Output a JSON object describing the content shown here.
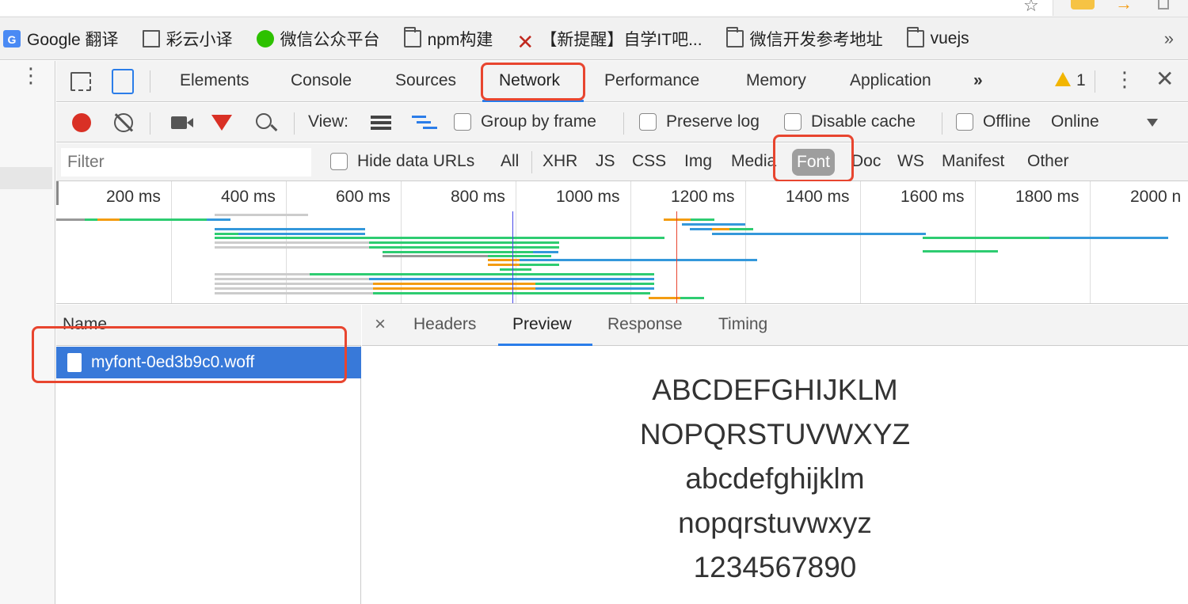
{
  "bookmarks": [
    {
      "icon": "google-translate-icon",
      "label": "Google 翻译"
    },
    {
      "icon": "page-icon",
      "label": "彩云小译"
    },
    {
      "icon": "wechat-icon",
      "label": "微信公众平台"
    },
    {
      "icon": "folder-icon",
      "label": "npm构建"
    },
    {
      "icon": "x-logo-icon",
      "label": "【新提醒】自学IT吧..."
    },
    {
      "icon": "folder-icon",
      "label": "微信开发参考地址"
    },
    {
      "icon": "folder-icon",
      "label": "vuejs"
    }
  ],
  "bookmarks_more": "»",
  "devtools": {
    "tabs": [
      "Elements",
      "Console",
      "Sources",
      "Network",
      "Performance",
      "Memory",
      "Application"
    ],
    "active_tab": "Network",
    "more_tabs": "»",
    "warning_count": "1"
  },
  "toolbar": {
    "view_label": "View:",
    "group_by_frame": "Group by frame",
    "preserve_log": "Preserve log",
    "disable_cache": "Disable cache",
    "offline": "Offline",
    "throttle": "Online"
  },
  "filter": {
    "placeholder": "Filter",
    "hide_data_urls": "Hide data URLs",
    "types": [
      "All",
      "XHR",
      "JS",
      "CSS",
      "Img",
      "Media",
      "Font",
      "Doc",
      "WS",
      "Manifest",
      "Other"
    ],
    "active_type": "Font"
  },
  "timeline": {
    "ticks": [
      "200 ms",
      "400 ms",
      "600 ms",
      "800 ms",
      "1000 ms",
      "1200 ms",
      "1400 ms",
      "1600 ms",
      "1800 ms",
      "2000 n"
    ]
  },
  "requests": {
    "header": "Name",
    "files": [
      "myfont-0ed3b9c0.woff"
    ]
  },
  "detail": {
    "close": "×",
    "tabs": [
      "Headers",
      "Preview",
      "Response",
      "Timing"
    ],
    "active_tab": "Preview",
    "preview_lines": [
      "ABCDEFGHIJKLM",
      "NOPQRSTUVWXYZ",
      "abcdefghijklm",
      "nopqrstuvwxyz",
      "1234567890"
    ]
  },
  "colors": {
    "highlight": "#e8452f",
    "selected_row": "#3879d9",
    "record": "#d93025",
    "filter_icon": "#d93025"
  }
}
